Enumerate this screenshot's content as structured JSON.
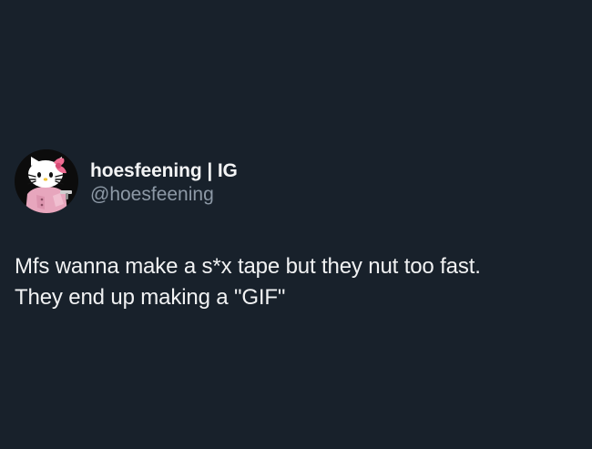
{
  "tweet": {
    "author": {
      "display_name": "hoesfeening | IG",
      "handle": "@hoesfeening",
      "avatar_icon": "hello-kitty-avatar-icon"
    },
    "text_lines": [
      "Mfs wanna make a s*x tape but they nut too fast.",
      "They end up making a \"GIF\""
    ]
  },
  "colors": {
    "background": "#18212b",
    "name": "#f3f4f5",
    "handle": "#8d99a6",
    "text": "#f1f2f3"
  }
}
